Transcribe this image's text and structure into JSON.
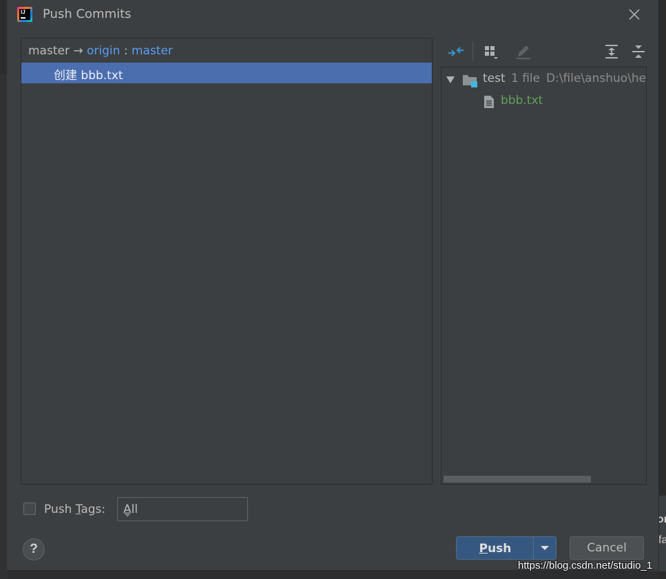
{
  "dialog": {
    "title": "Push Commits"
  },
  "commits": {
    "branch_local": "master",
    "arrow": "→",
    "remote": "origin",
    "separator": ":",
    "branch_remote": "master",
    "rows": [
      {
        "message": "创建  bbb.txt"
      }
    ]
  },
  "changes": {
    "root": {
      "name": "test",
      "count": "1 file",
      "path": "D:\\file\\anshuo\\he"
    },
    "files": [
      {
        "name": "bbb.txt",
        "color": "#62a05a"
      }
    ]
  },
  "toolbar": {
    "icons": [
      "expand-diff-icon",
      "group-by-icon",
      "edit-source-icon",
      "expand-all-icon",
      "collapse-all-icon"
    ]
  },
  "footer": {
    "push_tags_label_pre": "Push ",
    "push_tags_label_mnemonic": "T",
    "push_tags_label_post": "ags:",
    "push_tags_checked": false,
    "tags_select_value": "All",
    "push_label_mnemonic": "P",
    "push_label_rest": "ush",
    "cancel_label": "Cancel",
    "help_label": "?"
  },
  "background": {
    "peek_text_1": "or",
    "peek_text_2": "fa",
    "watermark": "https://blog.csdn.net/studio_1"
  },
  "colors": {
    "dialog_bg": "#3c3f41",
    "selection": "#4b6eaf",
    "link_blue": "#589df6",
    "push_button": "#365880",
    "file_added_green": "#62a05a"
  }
}
